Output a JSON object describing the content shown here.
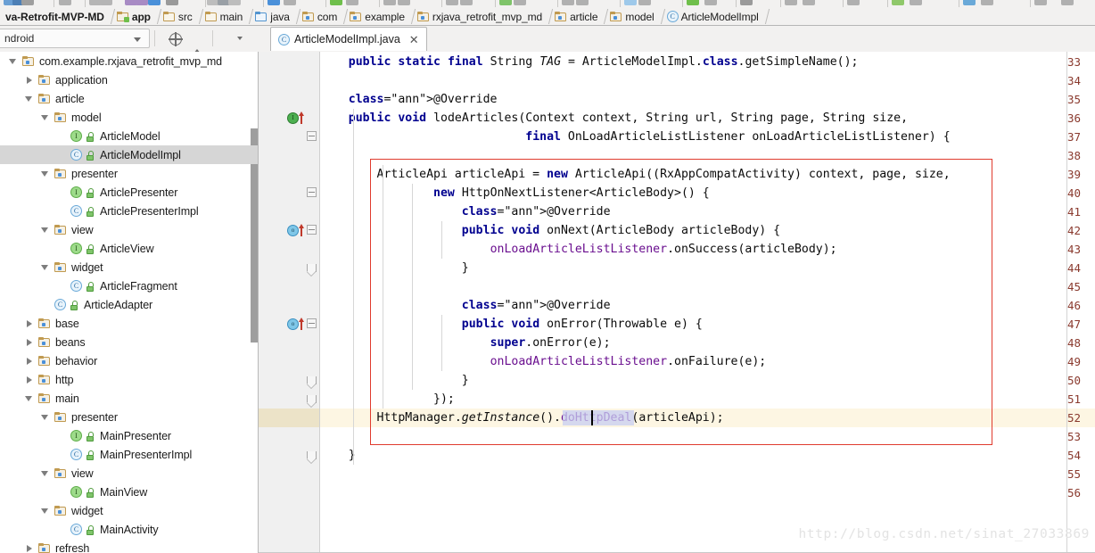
{
  "window": {
    "ide": "Android Studio"
  },
  "toolbar_strip": {
    "icons": [
      "open-icon",
      "save-icon",
      "sync-icon",
      "undo-icon",
      "redo-icon",
      "cut-icon",
      "copy-icon",
      "paste-icon",
      "find-icon",
      "back-icon",
      "forward-icon",
      "compile-icon",
      "run-icon",
      "debug-icon",
      "avd-icon",
      "sdk-icon",
      "search-icon"
    ]
  },
  "breadcrumb": {
    "items": [
      {
        "label": "va-Retrofit-MVP-MD",
        "icon": "none",
        "bold": true
      },
      {
        "label": "app",
        "icon": "module-icon",
        "bold": true
      },
      {
        "label": "src",
        "icon": "folder-plain-icon",
        "bold": false
      },
      {
        "label": "main",
        "icon": "folder-plain-icon",
        "bold": false
      },
      {
        "label": "java",
        "icon": "folder-source-root-icon",
        "bold": false
      },
      {
        "label": "com",
        "icon": "folder-package-icon",
        "bold": false
      },
      {
        "label": "example",
        "icon": "folder-package-icon",
        "bold": false
      },
      {
        "label": "rxjava_retrofit_mvp_md",
        "icon": "folder-package-icon",
        "bold": false
      },
      {
        "label": "article",
        "icon": "folder-package-icon",
        "bold": false
      },
      {
        "label": "model",
        "icon": "folder-package-icon",
        "bold": false
      },
      {
        "label": "ArticleModelImpl",
        "icon": "class-icon",
        "bold": false
      }
    ]
  },
  "secondbar": {
    "module_selector_value": "ndroid",
    "buttons": [
      {
        "name": "sync-with-editor-button",
        "icon": "sync-icon"
      },
      {
        "name": "collapse-all-button",
        "icon": "collapse-all-icon"
      },
      {
        "name": "settings-button",
        "icon": "gear-icon"
      },
      {
        "name": "scroll-from-source-button",
        "icon": "scroll-from-source-icon"
      }
    ]
  },
  "editor_tab": {
    "label": "ArticleModelImpl.java",
    "icon": "java-class-icon",
    "close": "✕"
  },
  "tree": [
    {
      "indent": 0,
      "twisty": "open",
      "icon": "folder-package-icon",
      "label": "com.example.rxjava_retrofit_mvp_md",
      "selected": false
    },
    {
      "indent": 1,
      "twisty": "closed",
      "icon": "folder-package-icon",
      "label": "application",
      "selected": false
    },
    {
      "indent": 1,
      "twisty": "open",
      "icon": "folder-package-icon",
      "label": "article",
      "selected": false
    },
    {
      "indent": 2,
      "twisty": "open",
      "icon": "folder-package-icon",
      "label": "model",
      "selected": false
    },
    {
      "indent": 3,
      "twisty": "none",
      "icon": "interface-icon",
      "label": "ArticleModel",
      "selected": false,
      "lock": true
    },
    {
      "indent": 3,
      "twisty": "none",
      "icon": "class-icon",
      "label": "ArticleModelImpl",
      "selected": true,
      "lock": true
    },
    {
      "indent": 2,
      "twisty": "open",
      "icon": "folder-package-icon",
      "label": "presenter",
      "selected": false
    },
    {
      "indent": 3,
      "twisty": "none",
      "icon": "interface-icon",
      "label": "ArticlePresenter",
      "selected": false,
      "lock": true
    },
    {
      "indent": 3,
      "twisty": "none",
      "icon": "class-icon",
      "label": "ArticlePresenterImpl",
      "selected": false,
      "lock": true
    },
    {
      "indent": 2,
      "twisty": "open",
      "icon": "folder-package-icon",
      "label": "view",
      "selected": false
    },
    {
      "indent": 3,
      "twisty": "none",
      "icon": "interface-icon",
      "label": "ArticleView",
      "selected": false,
      "lock": true
    },
    {
      "indent": 2,
      "twisty": "open",
      "icon": "folder-package-icon",
      "label": "widget",
      "selected": false
    },
    {
      "indent": 3,
      "twisty": "none",
      "icon": "class-icon",
      "label": "ArticleFragment",
      "selected": false,
      "lock": true
    },
    {
      "indent": 2,
      "twisty": "none",
      "icon": "class-icon",
      "label": "ArticleAdapter",
      "selected": false,
      "lock": true
    },
    {
      "indent": 1,
      "twisty": "closed",
      "icon": "folder-package-icon",
      "label": "base",
      "selected": false
    },
    {
      "indent": 1,
      "twisty": "closed",
      "icon": "folder-package-icon",
      "label": "beans",
      "selected": false
    },
    {
      "indent": 1,
      "twisty": "closed",
      "icon": "folder-package-icon",
      "label": "behavior",
      "selected": false
    },
    {
      "indent": 1,
      "twisty": "closed",
      "icon": "folder-package-icon",
      "label": "http",
      "selected": false
    },
    {
      "indent": 1,
      "twisty": "open",
      "icon": "folder-package-icon",
      "label": "main",
      "selected": false
    },
    {
      "indent": 2,
      "twisty": "open",
      "icon": "folder-package-icon",
      "label": "presenter",
      "selected": false
    },
    {
      "indent": 3,
      "twisty": "none",
      "icon": "interface-icon",
      "label": "MainPresenter",
      "selected": false,
      "lock": true
    },
    {
      "indent": 3,
      "twisty": "none",
      "icon": "class-icon",
      "label": "MainPresenterImpl",
      "selected": false,
      "lock": true
    },
    {
      "indent": 2,
      "twisty": "open",
      "icon": "folder-package-icon",
      "label": "view",
      "selected": false
    },
    {
      "indent": 3,
      "twisty": "none",
      "icon": "interface-icon",
      "label": "MainView",
      "selected": false,
      "lock": true
    },
    {
      "indent": 2,
      "twisty": "open",
      "icon": "folder-package-icon",
      "label": "widget",
      "selected": false
    },
    {
      "indent": 3,
      "twisty": "none",
      "icon": "class-icon",
      "label": "MainActivity",
      "selected": false,
      "lock": true
    },
    {
      "indent": 1,
      "twisty": "closed",
      "icon": "folder-package-icon",
      "label": "refresh",
      "selected": false
    }
  ],
  "editor": {
    "first_line": 33,
    "highlighted_line": 52,
    "gutter_markers": [
      {
        "line": 36,
        "type": "implementing-method-marker",
        "glyph": "I"
      },
      {
        "line": 42,
        "type": "overriding-method-marker",
        "glyph": "o"
      },
      {
        "line": 47,
        "type": "overriding-method-marker",
        "glyph": "o"
      }
    ],
    "selection": {
      "line": 52,
      "text": "doHttpDeal"
    },
    "lines": [
      {
        "n": 33,
        "text": "    public static final String TAG = ArticleModelImpl.class.getSimpleName();"
      },
      {
        "n": 34,
        "text": ""
      },
      {
        "n": 35,
        "text": "    @Override"
      },
      {
        "n": 36,
        "text": "    public void lodeArticles(Context context, String url, String page, String size,"
      },
      {
        "n": 37,
        "text": "                             final OnLoadArticleListListener onLoadArticleListListener) {"
      },
      {
        "n": 38,
        "text": ""
      },
      {
        "n": 39,
        "text": "        ArticleApi articleApi = new ArticleApi((RxAppCompatActivity) context, page, size,"
      },
      {
        "n": 40,
        "text": "                new HttpOnNextListener<ArticleBody>() {"
      },
      {
        "n": 41,
        "text": "                    @Override"
      },
      {
        "n": 42,
        "text": "                    public void onNext(ArticleBody articleBody) {"
      },
      {
        "n": 43,
        "text": "                        onLoadArticleListListener.onSuccess(articleBody);"
      },
      {
        "n": 44,
        "text": "                    }"
      },
      {
        "n": 45,
        "text": ""
      },
      {
        "n": 46,
        "text": "                    @Override"
      },
      {
        "n": 47,
        "text": "                    public void onError(Throwable e) {"
      },
      {
        "n": 48,
        "text": "                        super.onError(e);"
      },
      {
        "n": 49,
        "text": "                        onLoadArticleListListener.onFailure(e);"
      },
      {
        "n": 50,
        "text": "                    }"
      },
      {
        "n": 51,
        "text": "                });"
      },
      {
        "n": 52,
        "text": "        HttpManager.getInstance().doHttpDeal(articleApi);"
      },
      {
        "n": 53,
        "text": ""
      },
      {
        "n": 54,
        "text": "    }"
      },
      {
        "n": 55,
        "text": ""
      },
      {
        "n": 56,
        "text": ""
      }
    ]
  },
  "watermark": {
    "text": "http://blog.csdn.net/sinat_27033869"
  },
  "colors": {
    "keyword": "#00008f",
    "annotation": "#808000",
    "field": "#6a0f8f",
    "line_number": "#8a3a2e",
    "highlight_row": "#fdf6e3",
    "red_box": "#e03b2e",
    "selection": "#c7cdf2",
    "tree_selection": "#d6d6d6"
  }
}
